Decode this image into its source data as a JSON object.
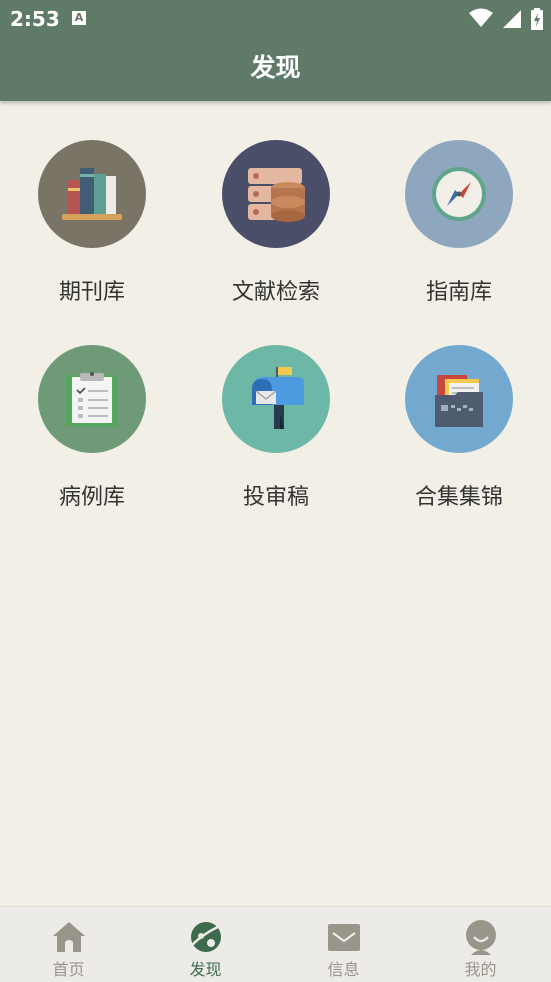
{
  "status_bar": {
    "time": "2:53",
    "notification_letter": "A"
  },
  "header": {
    "title": "发现"
  },
  "grid": {
    "items": [
      {
        "label": "期刊库"
      },
      {
        "label": "文献检索"
      },
      {
        "label": "指南库"
      },
      {
        "label": "病例库"
      },
      {
        "label": "投审稿"
      },
      {
        "label": "合集集锦"
      }
    ]
  },
  "tabbar": {
    "tabs": [
      {
        "label": "首页"
      },
      {
        "label": "发现"
      },
      {
        "label": "信息"
      },
      {
        "label": "我的"
      }
    ],
    "active_tab": "发现"
  },
  "colors": {
    "header_bg": "#5f7a66",
    "page_bg": "#f2efe6",
    "tab_active": "#3e6b4d",
    "tab_inactive": "#9a958b"
  }
}
